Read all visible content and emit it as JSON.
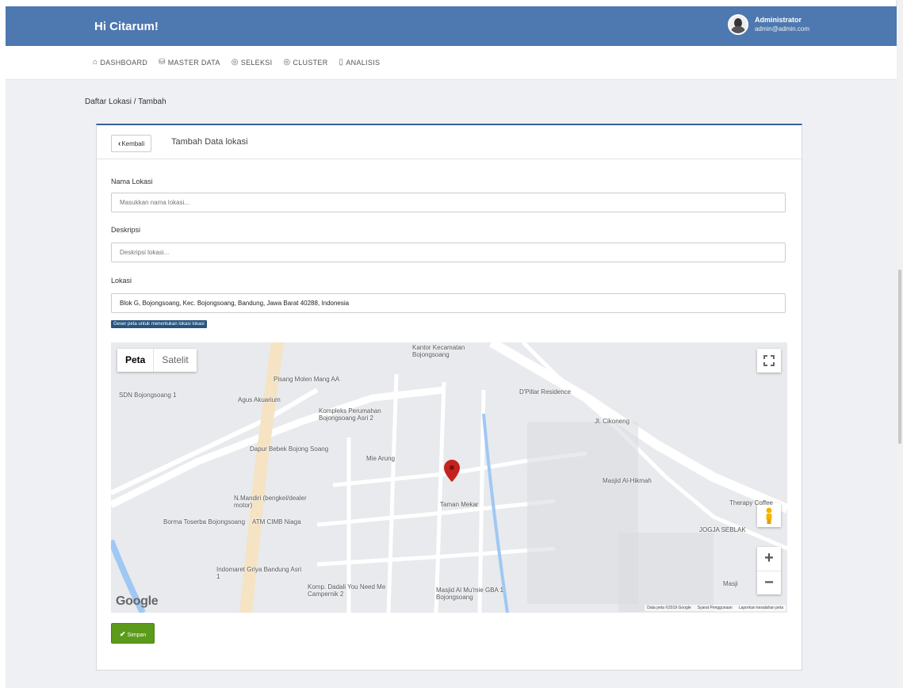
{
  "header": {
    "brand": "Hi Citarum!",
    "user_name": "Administrator",
    "user_email": "admin@admin.com"
  },
  "nav": [
    {
      "icon": "home-icon",
      "glyph": "⌂",
      "label": "DASHBOARD"
    },
    {
      "icon": "database-icon",
      "glyph": "⛁",
      "label": "MASTER DATA"
    },
    {
      "icon": "map-pin-icon",
      "glyph": "◎",
      "label": "SELEKSI"
    },
    {
      "icon": "map-pin-icon",
      "glyph": "◎",
      "label": "CLUSTER"
    },
    {
      "icon": "document-icon",
      "glyph": "▯",
      "label": "ANALISIS"
    }
  ],
  "breadcrumb": "Daftar Lokasi / Tambah",
  "card": {
    "back_label": "Kembali",
    "title": "Tambah Data lokasi"
  },
  "form": {
    "name_label": "Nama Lokasi",
    "name_placeholder": "Masukkan nama lokasi...",
    "desc_label": "Deskripsi",
    "desc_placeholder": "Deskripsi lokasi...",
    "loc_label": "Lokasi",
    "loc_value": "Blok G, Bojongsoang, Kec. Bojongsoang, Bandung, Jawa Barat 40288, Indonesia",
    "hint": "Geser peta untuk menentukan lokasi lokasi"
  },
  "map": {
    "type_map": "Peta",
    "type_sat": "Satelit",
    "labels": [
      "Kantor Kecamatan Bojongsoang",
      "Pisang Molen Mang AA",
      "SDN Bojongsoang 1",
      "Agus Akuarium",
      "Kompleks Perumahan Bojongsoang Asri 2",
      "D'Pillar Residence",
      "Jl. Cikoneng",
      "Dapur Bebek Bojong Soang",
      "Mie Arung",
      "N.Mandiri (bengkel/dealer motor)",
      "Masjid Al-Hikmah",
      "Borma Toserba Bojongsoang",
      "ATM CIMB Niaga",
      "Taman Mekar",
      "Therapy Coffee",
      "JOGJA SEBLAK",
      "Indomaret Griya Bandung Asri 1",
      "Komp. Dadali You Need Me Campernik 2",
      "Masjid Al Mu'mie GBA 1 Bojongsoang",
      "Masji"
    ],
    "google": "Google",
    "attribution": [
      "Data peta ©2019 Google",
      "Syarat Penggunaan",
      "Laporkan kesalahan peta"
    ],
    "zoom_in": "+",
    "zoom_out": "−",
    "colors": {
      "road": "#ffffff",
      "block": "#e8eaed",
      "water": "#9fc8f4",
      "pin": "#c5221f"
    }
  },
  "save_label": "Simpan"
}
